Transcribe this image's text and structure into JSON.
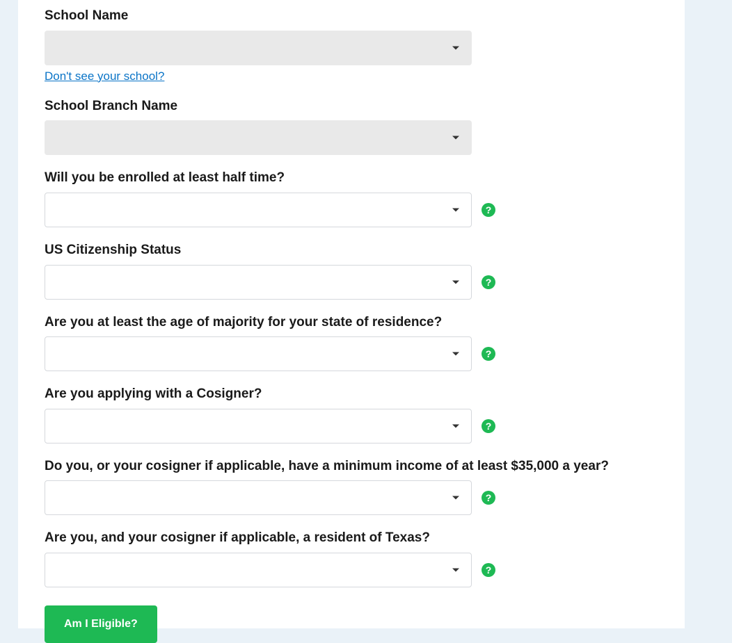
{
  "form": {
    "school_name": {
      "label": "School Name",
      "value": "",
      "missing_link": "Don't see your school?"
    },
    "school_branch": {
      "label": "School Branch Name",
      "value": ""
    },
    "half_time": {
      "label": "Will you be enrolled at least half time?",
      "value": ""
    },
    "citizenship": {
      "label": "US Citizenship Status",
      "value": ""
    },
    "age_majority": {
      "label": "Are you at least the age of majority for your state of residence?",
      "value": ""
    },
    "cosigner": {
      "label": "Are you applying with a Cosigner?",
      "value": ""
    },
    "min_income": {
      "label": "Do you, or your cosigner if applicable, have a minimum income of at least $35,000 a year?",
      "value": ""
    },
    "texas_resident": {
      "label": "Are you, and your cosigner if applicable, a resident of Texas?",
      "value": ""
    },
    "submit_label": "Am I Eligible?"
  },
  "help_glyph": "?"
}
